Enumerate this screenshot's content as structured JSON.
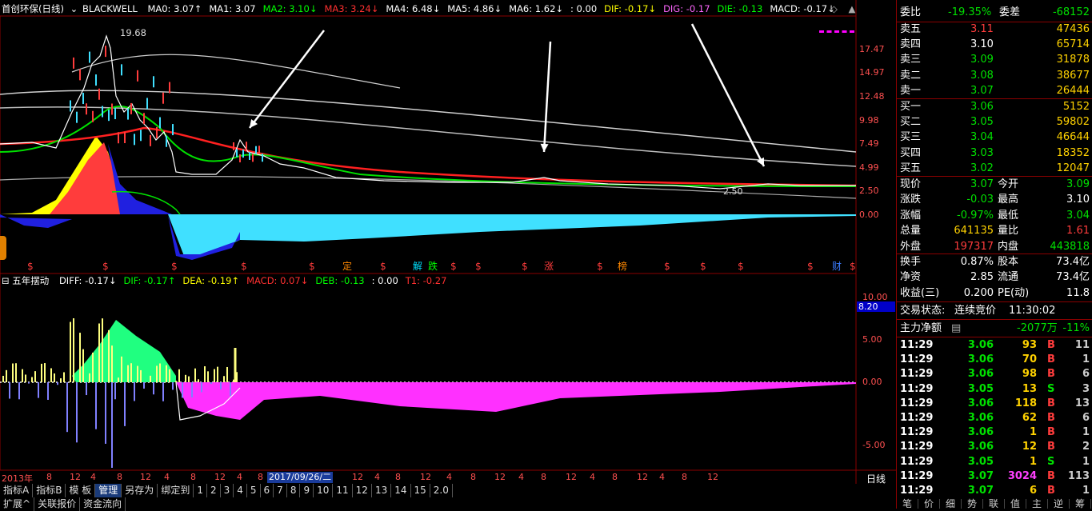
{
  "header": {
    "stock": "首创环保(日线)",
    "indicator": "BLACKWELL",
    "items": [
      {
        "t": "MA0: 3.07↑",
        "c": "#ffffff"
      },
      {
        "t": "MA1: 3.07",
        "c": "#ffffff"
      },
      {
        "t": "MA2: 3.10↓",
        "c": "#00ff00"
      },
      {
        "t": "MA3: 3.24↓",
        "c": "#ff3030"
      },
      {
        "t": "MA4: 6.48↓",
        "c": "#ffffff"
      },
      {
        "t": "MA5: 4.86↓",
        "c": "#ffffff"
      },
      {
        "t": "MA6: 1.62↓",
        "c": "#ffffff"
      },
      {
        "t": ": 0.00",
        "c": "#ffffff"
      },
      {
        "t": "DIF: -0.17↓",
        "c": "#ffff00"
      },
      {
        "t": "DIG: -0.17",
        "c": "#ff66ff"
      },
      {
        "t": "DIE: -0.13",
        "c": "#00ff00"
      },
      {
        "t": "MACD: -0.17↓",
        "c": "#ffffff"
      }
    ]
  },
  "upper_axis": [
    "17.47",
    "14.97",
    "12.48",
    "9.98",
    "7.49",
    "4.99",
    "2.50",
    "0.00"
  ],
  "annotations": {
    "high": "19.68",
    "low": "2.50"
  },
  "signal_labels": [
    "$",
    "$",
    "$",
    "$",
    "$",
    "定",
    "$",
    "解",
    "跌",
    "$",
    "$",
    "$",
    "涨",
    "$",
    "榜",
    "$",
    "$",
    "$",
    "$",
    "财",
    "$"
  ],
  "lower_header": {
    "name": "五年摆动",
    "items": [
      {
        "t": "DIFF: -0.17↓",
        "c": "#ffffff"
      },
      {
        "t": "DIF: -0.17↑",
        "c": "#00ff00"
      },
      {
        "t": "DEA: -0.19↑",
        "c": "#ffff00"
      },
      {
        "t": "MACD: 0.07↓",
        "c": "#ff3030"
      },
      {
        "t": "DEB: -0.13",
        "c": "#00ff00"
      },
      {
        "t": ": 0.00",
        "c": "#ffffff"
      },
      {
        "t": "T1: -0.27",
        "c": "#ff3030"
      }
    ]
  },
  "lower_axis": [
    "10.00",
    "5.00",
    "0.00",
    "-5.00"
  ],
  "lower_marker": "8.20",
  "x_axis": {
    "labels": [
      "2013年",
      "8",
      "12",
      "4",
      "8",
      "12",
      "4",
      "8",
      "12",
      "4",
      "8",
      "12",
      "4",
      "8",
      "12",
      "4",
      "8",
      "12",
      "4",
      "8",
      "12",
      "4",
      "8",
      "12",
      "4",
      "8",
      "12"
    ],
    "date_box": "2017/09/26/二",
    "period": "日线"
  },
  "bottom_tabs": [
    "指标A",
    "指标B",
    "模 板",
    "管理",
    "另存为",
    "绑定到",
    "1",
    "2",
    "3",
    "4",
    "5",
    "6",
    "7",
    "8",
    "9",
    "10",
    "11",
    "12",
    "13",
    "14",
    "15",
    "2.0"
  ],
  "bottom_row2": [
    "扩展^",
    "关联报价",
    "资金流向"
  ],
  "quote": {
    "webi": {
      "label": "委比",
      "value": "-19.35%",
      "label2": "委差",
      "value2": "-68152"
    },
    "sells": [
      {
        "label": "卖五",
        "price": "3.11",
        "vol": "47436",
        "pc": "red"
      },
      {
        "label": "卖四",
        "price": "3.10",
        "vol": "65714",
        "pc": "white"
      },
      {
        "label": "卖三",
        "price": "3.09",
        "vol": "31878",
        "pc": "green"
      },
      {
        "label": "卖二",
        "price": "3.08",
        "vol": "38677",
        "pc": "green"
      },
      {
        "label": "卖一",
        "price": "3.07",
        "vol": "26444",
        "pc": "green"
      }
    ],
    "buys": [
      {
        "label": "买一",
        "price": "3.06",
        "vol": "5152",
        "pc": "green"
      },
      {
        "label": "买二",
        "price": "3.05",
        "vol": "59802",
        "pc": "green"
      },
      {
        "label": "买三",
        "price": "3.04",
        "vol": "46644",
        "pc": "green"
      },
      {
        "label": "买四",
        "price": "3.03",
        "vol": "18352",
        "pc": "green"
      },
      {
        "label": "买五",
        "price": "3.02",
        "vol": "12047",
        "pc": "green"
      }
    ],
    "stats": [
      {
        "l1": "现价",
        "v1": "3.07",
        "c1": "green",
        "l2": "今开",
        "v2": "3.09",
        "c2": "green"
      },
      {
        "l1": "涨跌",
        "v1": "-0.03",
        "c1": "green",
        "l2": "最高",
        "v2": "3.10",
        "c2": "white"
      },
      {
        "l1": "涨幅",
        "v1": "-0.97%",
        "c1": "green",
        "l2": "最低",
        "v2": "3.04",
        "c2": "green"
      },
      {
        "l1": "总量",
        "v1": "641135",
        "c1": "yellow",
        "l2": "量比",
        "v2": "1.61",
        "c2": "red"
      },
      {
        "l1": "外盘",
        "v1": "197317",
        "c1": "red",
        "l2": "内盘",
        "v2": "443818",
        "c2": "green"
      }
    ],
    "stats2": [
      {
        "l1": "换手",
        "v1": "0.87%",
        "c1": "white",
        "l2": "股本",
        "v2": "73.4亿",
        "c2": "white"
      },
      {
        "l1": "净资",
        "v1": "2.85",
        "c1": "white",
        "l2": "流通",
        "v2": "73.4亿",
        "c2": "white"
      },
      {
        "l1": "收益(三)",
        "v1": "0.200",
        "c1": "white",
        "l2": "PE(动)",
        "v2": "11.8",
        "c2": "white"
      }
    ],
    "trade_status": {
      "label": "交易状态:",
      "value": "连续竞价",
      "time": "11:30:02"
    },
    "main_flow": {
      "label": "主力净额",
      "value": "-2077万",
      "pct": "-11%"
    },
    "ticks": [
      {
        "t": "11:29",
        "p": "3.06",
        "v": "93",
        "bs": "B",
        "n": "11",
        "vc": "yellow"
      },
      {
        "t": "11:29",
        "p": "3.06",
        "v": "70",
        "bs": "B",
        "n": "1",
        "vc": "yellow"
      },
      {
        "t": "11:29",
        "p": "3.06",
        "v": "98",
        "bs": "B",
        "n": "6",
        "vc": "yellow"
      },
      {
        "t": "11:29",
        "p": "3.05",
        "v": "13",
        "bs": "S",
        "n": "3",
        "vc": "yellow"
      },
      {
        "t": "11:29",
        "p": "3.06",
        "v": "118",
        "bs": "B",
        "n": "13",
        "vc": "yellow"
      },
      {
        "t": "11:29",
        "p": "3.06",
        "v": "62",
        "bs": "B",
        "n": "6",
        "vc": "yellow"
      },
      {
        "t": "11:29",
        "p": "3.06",
        "v": "1",
        "bs": "B",
        "n": "1",
        "vc": "yellow"
      },
      {
        "t": "11:29",
        "p": "3.06",
        "v": "12",
        "bs": "B",
        "n": "2",
        "vc": "yellow"
      },
      {
        "t": "11:29",
        "p": "3.05",
        "v": "1",
        "bs": "S",
        "n": "1",
        "vc": "yellow"
      },
      {
        "t": "11:29",
        "p": "3.07",
        "v": "3024",
        "bs": "B",
        "n": "113",
        "vc": "magenta"
      },
      {
        "t": "11:29",
        "p": "3.07",
        "v": "6",
        "bs": "B",
        "n": "1",
        "vc": "yellow"
      }
    ],
    "bottom_tabs": [
      "笔",
      "价",
      "细",
      "势",
      "联",
      "值",
      "主",
      "逆",
      "筹"
    ]
  }
}
